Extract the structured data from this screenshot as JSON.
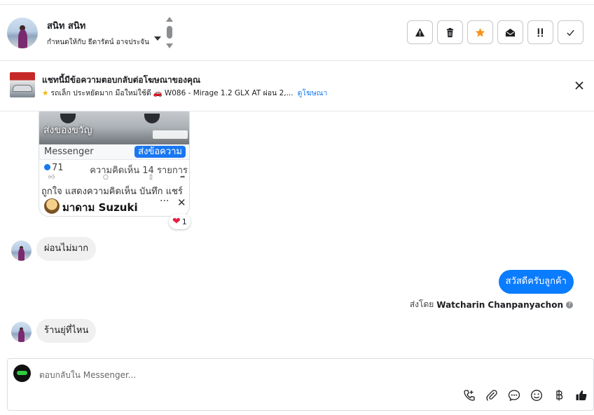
{
  "header": {
    "contact_name": "สนิท สนิท",
    "assigned_to": "กำหนดให้กับ ธีดารัตน์ อาจประจัน",
    "actions": [
      {
        "name": "report-button",
        "icon": "warning-icon"
      },
      {
        "name": "delete-button",
        "icon": "trash-icon"
      },
      {
        "name": "star-button",
        "icon": "star-icon"
      },
      {
        "name": "mark-unread-button",
        "icon": "envelope-open-icon"
      },
      {
        "name": "follow-up-button",
        "icon": "exclamation-icon"
      },
      {
        "name": "done-button",
        "icon": "check-icon"
      }
    ]
  },
  "ad_reply": {
    "title": "แชทนี้มีข้อความตอบกลับต่อโฆษณาของคุณ",
    "desc_part1": "รถเล็ก ประหยัดมาก มือใหม่ใช้ดี",
    "desc_part2": "W086 - Mirage 1.2 GLX AT ผ่อน 2,...",
    "view_ad_link": "ดูโฆษณา"
  },
  "shared_post": {
    "gift_label": "ส่งของขวัญ",
    "messenger_label": "Messenger",
    "send_message_label": "ส่งข้อความ",
    "likes_count": "71",
    "comments_text": "ความคิดเห็น 14 รายการ",
    "actions_text": "ถูกใจ แสดงความคิดเห็น บันทึก แชร์",
    "page_name": "มาดาม Suzuki",
    "more_label": "···",
    "close_label": "✕",
    "reaction_count": "1"
  },
  "messages": [
    {
      "direction": "in",
      "text": "ผ่อนไม่มาก"
    },
    {
      "direction": "out",
      "text": "สวัสดีครับลูกค้า"
    },
    {
      "direction": "in",
      "text": "ร้านยุ่ที่ไหน"
    }
  ],
  "sent_by": {
    "prefix": "ส่งโดย",
    "agent_name": "Watcharin Chanpanyachon"
  },
  "composer": {
    "placeholder": "ตอบกลับใน Messenger...",
    "tools": [
      "call-icon",
      "attachment-icon",
      "saved-reply-icon",
      "emoji-icon",
      "baht-icon",
      "like-icon"
    ]
  },
  "colors": {
    "accent_blue": "#0a7cff",
    "star_orange": "#f7931e",
    "bubble_gray": "#f0f0f0"
  }
}
